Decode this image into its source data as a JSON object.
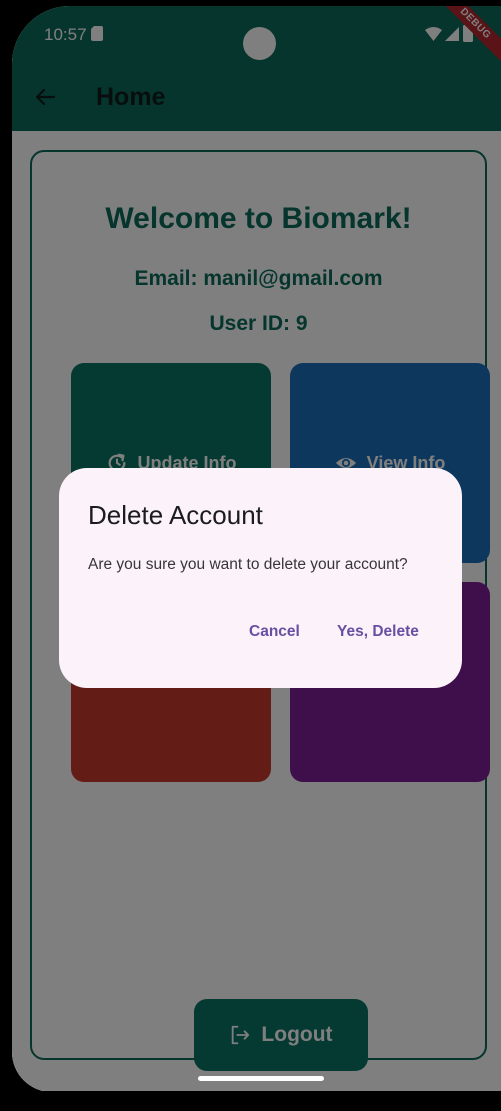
{
  "status_bar": {
    "time": "10:57",
    "icons": [
      "sim-card-icon",
      "wifi-icon",
      "signal-icon",
      "battery-icon"
    ],
    "debug_label": "DEBUG"
  },
  "app_bar": {
    "back_icon": "arrow-left-icon",
    "title": "Home",
    "color": "#0b6b5a"
  },
  "main": {
    "welcome": "Welcome to Biomark!",
    "email": "Email: manil@gmail.com",
    "user_id": "User ID: 9",
    "tiles": [
      {
        "label": "Update Info",
        "icon": "refresh-icon",
        "color": "#0b7565"
      },
      {
        "label": "View Info",
        "icon": "eye-icon",
        "color": "#1b6fbb"
      },
      {
        "label": "",
        "color": "#c63a2c"
      },
      {
        "label": "",
        "color": "#7d1f94"
      }
    ],
    "logout_label": "Logout",
    "logout_icon": "logout-icon"
  },
  "dialog": {
    "title": "Delete Account",
    "message": "Are you sure you want to delete your account?",
    "cancel_label": "Cancel",
    "confirm_label": "Yes, Delete",
    "accent": "#6750a4"
  }
}
